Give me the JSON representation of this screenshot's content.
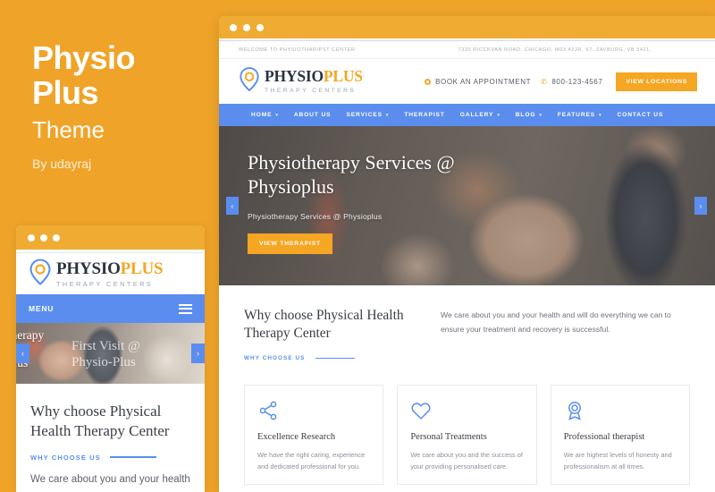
{
  "promo": {
    "title_line1": "Physio",
    "title_line2": "Plus",
    "subtitle": "Theme",
    "author": "By udayraj"
  },
  "colors": {
    "page_background": "#efa429",
    "brand_orange": "#f5a623",
    "brand_blue": "#5b8def",
    "logo_dark": "#2b3340",
    "chrome_orange": "#f0ab33"
  },
  "logo": {
    "name_dark": "PHYSIO",
    "name_orange": "PLUS",
    "tagline": "THERAPY CENTERS",
    "pin_icon": "map-pin-icon"
  },
  "desktop": {
    "chrome": {
      "dots": 3
    },
    "topbar": {
      "welcome": "WELCOME TO PHYSIOTHARIPST CENTER",
      "address": "7320 RICCKVAN ROAD, CHICAGO, M03 42JR, ST. ZAVBURG, VB 5421."
    },
    "header": {
      "appointment_label": "BOOK AN APPOINTMENT",
      "appointment_icon": "circle-dot-icon",
      "phone": "800-123-4567",
      "phone_icon": "phone-icon",
      "locations_button": "VIEW LOCATIONS"
    },
    "nav": [
      {
        "label": "HOME",
        "has_caret": true
      },
      {
        "label": "ABOUT US",
        "has_caret": false
      },
      {
        "label": "SERVICES",
        "has_caret": true
      },
      {
        "label": "THERAPIST",
        "has_caret": false
      },
      {
        "label": "GALLERY",
        "has_caret": true
      },
      {
        "label": "BLOG",
        "has_caret": true
      },
      {
        "label": "FEATURES",
        "has_caret": true
      },
      {
        "label": "CONTACT US",
        "has_caret": false
      }
    ],
    "hero": {
      "heading": "Physiotherapy Services @ Physioplus",
      "subheading": "Physiotherapy Services @ Physioplus",
      "button": "VIEW THERAPIST",
      "prev_icon": "chevron-left-icon",
      "next_icon": "chevron-right-icon"
    },
    "why": {
      "heading": "Why choose Physical Health Therapy Center",
      "eyebrow": "WHY CHOOSE US",
      "paragraph": "We care about you and your health and will do everything we can to ensure your treatment and recovery is successful."
    },
    "cards": [
      {
        "icon": "share-icon",
        "title": "Excellence Research",
        "text": "We have the right caring, experience and dedicated professional for you."
      },
      {
        "icon": "heart-icon",
        "title": "Personal Treatments",
        "text": "We care about you and the success of your providing personalised care."
      },
      {
        "icon": "award-icon",
        "title": "Professional therapist",
        "text": "We are highest levels of honesty and professionalism at all times."
      }
    ]
  },
  "mobile": {
    "chrome": {
      "dots": 3
    },
    "menu_label": "MENU",
    "menu_icon": "hamburger-icon",
    "slide_left_text_line1": "otherapy",
    "slide_left_text_line2": "s @",
    "slide_left_text_line3": "oplus",
    "slide_center_line1": "First Visit @",
    "slide_center_line2": "Physio-Plus",
    "prev_icon": "chevron-left-icon",
    "next_icon": "chevron-right-icon",
    "heading": "Why choose Physical Health Therapy Center",
    "eyebrow": "WHY CHOOSE US",
    "paragraph": "We care about you and your health"
  }
}
